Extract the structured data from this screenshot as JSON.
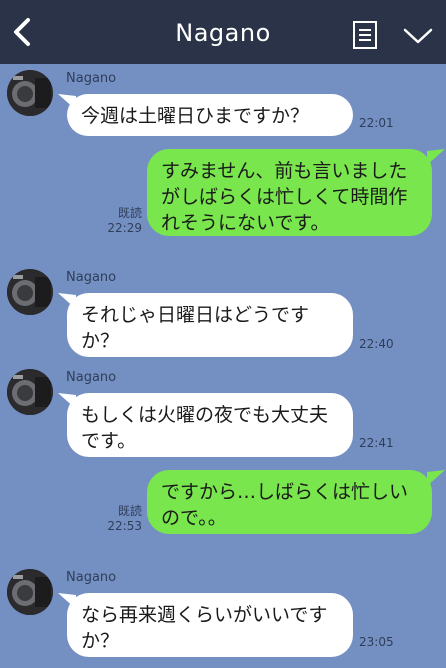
{
  "header": {
    "title": "Nagano",
    "back_icon": "chevron-left-icon",
    "menu_icon": "note-list-icon",
    "expand_icon": "chevron-down-icon"
  },
  "colors": {
    "background": "#7490c3",
    "header": "#2a3347",
    "incoming_bubble": "#ffffff",
    "outgoing_bubble": "#78e64c"
  },
  "messages": [
    {
      "direction": "in",
      "sender": "Nagano",
      "text": "今週は土曜日ひまですか？",
      "time": "22:01"
    },
    {
      "direction": "out",
      "text": "すみません、前も言いましたがしばらくは忙しくて時間作れそうにないです。",
      "read": "既読",
      "time": "22:29"
    },
    {
      "direction": "in",
      "sender": "Nagano",
      "text": "それじゃ日曜日はどうですか？",
      "time": "22:40"
    },
    {
      "direction": "in",
      "sender": "Nagano",
      "text": "もしくは火曜の夜でも大丈夫です。",
      "time": "22:41"
    },
    {
      "direction": "out",
      "text": "ですから…しばらくは忙しいので。。",
      "read": "既読",
      "time": "22:53"
    },
    {
      "direction": "in",
      "sender": "Nagano",
      "text": "なら再来週くらいがいいですか？",
      "time": "23:05"
    }
  ]
}
